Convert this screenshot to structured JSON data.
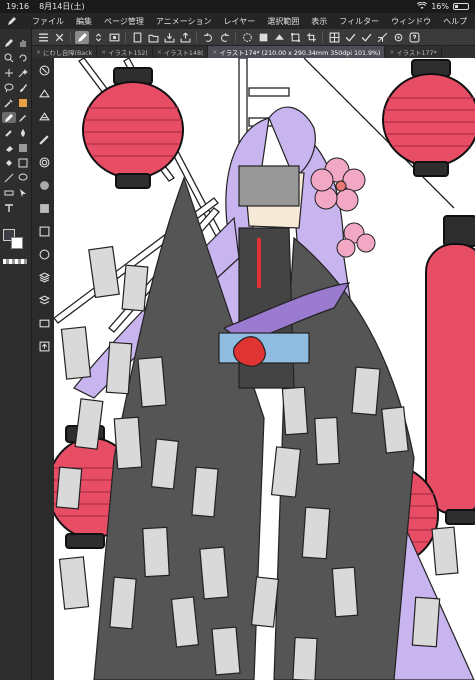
{
  "status_bar": {
    "time": "19:16",
    "date": "8月14日(土)",
    "battery": "16%"
  },
  "menu": [
    "ファイル",
    "編集",
    "ページ管理",
    "アニメーション",
    "レイヤー",
    "選択範囲",
    "表示",
    "フィルター",
    "ウィンドウ",
    "ヘルプ"
  ],
  "tabs": [
    {
      "label": "にわし自障(Back",
      "active": false
    },
    {
      "label": "イラスト152(",
      "active": false
    },
    {
      "label": "イラスト148(",
      "active": false
    },
    {
      "label": "イラスト174* (210.00 x 290.34mm 350dpi 101.9%)",
      "active": true
    },
    {
      "label": "イラスト177*",
      "active": false
    }
  ],
  "colors": {
    "main": "#3d3d44",
    "sub": "#ffffff",
    "ui_dark": "#2b2b2b",
    "lantern": "#e84d66",
    "hair": "#c8b4ee"
  },
  "tools": [
    "pen-icon",
    "brush-icon",
    "hand-icon",
    "search-icon",
    "rotate-icon",
    "move-icon",
    "lasso-icon",
    "magic-wand-icon",
    "eyedropper-icon",
    "stamp-icon",
    "eraser-icon",
    "blend-icon",
    "fill-icon",
    "gradient-icon",
    "line-icon",
    "shape-icon",
    "ruler-icon",
    "balloon-icon",
    "text-icon",
    "arrow-select-icon"
  ]
}
